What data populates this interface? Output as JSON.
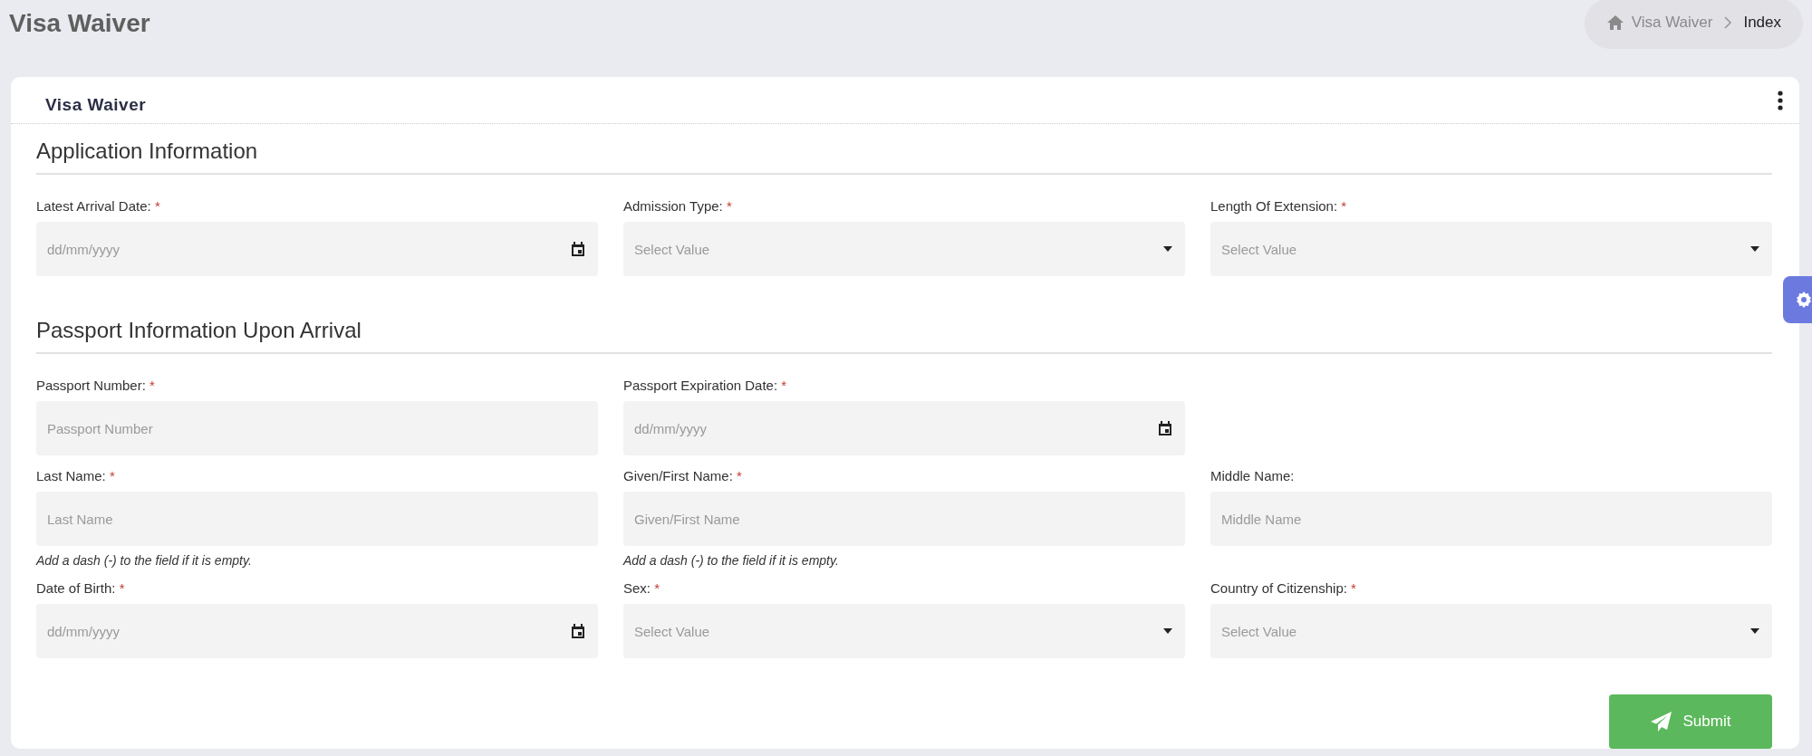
{
  "page_title": "Visa Waiver",
  "breadcrumb": [
    {
      "label": "Visa Waiver",
      "kind": "home",
      "selected": false
    },
    {
      "label": "Index",
      "kind": "page",
      "selected": true
    }
  ],
  "card": {
    "title": "Visa Waiver",
    "sections": [
      {
        "title": "Application Information",
        "rows": [
          [
            {
              "label": "Latest Arrival Date:",
              "required": true,
              "kind": "date",
              "placeholder": "dd/mm/yyyy"
            },
            {
              "label": "Admission Type:",
              "required": true,
              "kind": "select",
              "placeholder": "Select Value"
            },
            {
              "label": "Length Of Extension:",
              "required": true,
              "kind": "select",
              "placeholder": "Select Value"
            }
          ]
        ]
      },
      {
        "title": "Passport Information Upon Arrival",
        "rows": [
          [
            {
              "label": "Passport Number:",
              "required": true,
              "kind": "text",
              "placeholder": "Passport Number"
            },
            {
              "label": "Passport Expiration Date:",
              "required": true,
              "kind": "date",
              "placeholder": "dd/mm/yyyy"
            }
          ],
          [
            {
              "label": "Last Name:",
              "required": true,
              "kind": "text",
              "placeholder": "Last Name",
              "hint": "Add a dash (-) to the field if it is empty."
            },
            {
              "label": "Given/First Name:",
              "required": true,
              "kind": "text",
              "placeholder": "Given/First Name",
              "hint": "Add a dash (-) to the field if it is empty."
            },
            {
              "label": "Middle Name:",
              "required": false,
              "kind": "text",
              "placeholder": "Middle Name"
            }
          ],
          [
            {
              "label": "Date of Birth:",
              "required": true,
              "kind": "date",
              "placeholder": "dd/mm/yyyy"
            },
            {
              "label": "Sex:",
              "required": true,
              "kind": "select",
              "placeholder": "Select Value"
            },
            {
              "label": "Country of Citizenship:",
              "required": true,
              "kind": "select",
              "placeholder": "Select Value"
            }
          ]
        ]
      }
    ],
    "submit": "Submit"
  },
  "required_mark": "*"
}
